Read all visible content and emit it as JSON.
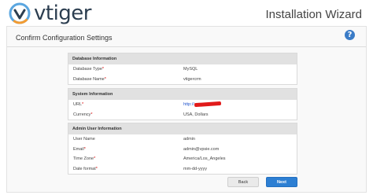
{
  "header": {
    "logo_text": "vtiger",
    "wizard_title": "Installation Wizard"
  },
  "panel": {
    "title": "Confirm Configuration Settings",
    "help_symbol": "?"
  },
  "sections": {
    "database": {
      "title": "Database Information",
      "rows": [
        {
          "label": "Database Type",
          "value": "MySQL"
        },
        {
          "label": "Database Name",
          "value": "vtigercrm"
        }
      ]
    },
    "system": {
      "title": "System Information",
      "rows": [
        {
          "label": "URL",
          "value": "http://"
        },
        {
          "label": "Currency",
          "value": "USA, Dollars"
        }
      ]
    },
    "admin": {
      "title": "Admin User Information",
      "rows": [
        {
          "label": "User Name",
          "value": "admin"
        },
        {
          "label": "Email",
          "value": "admin@vpsie.com"
        },
        {
          "label": "Time Zone",
          "value": "America/Los_Angeles"
        },
        {
          "label": "Date format",
          "value": "mm-dd-yyyy"
        }
      ]
    }
  },
  "buttons": {
    "back": "Back",
    "next": "Next"
  },
  "colors": {
    "accent": "#2d7fd3",
    "required": "#d90000",
    "section_header": "#e1e1e1",
    "redaction": "#e11a1a"
  }
}
